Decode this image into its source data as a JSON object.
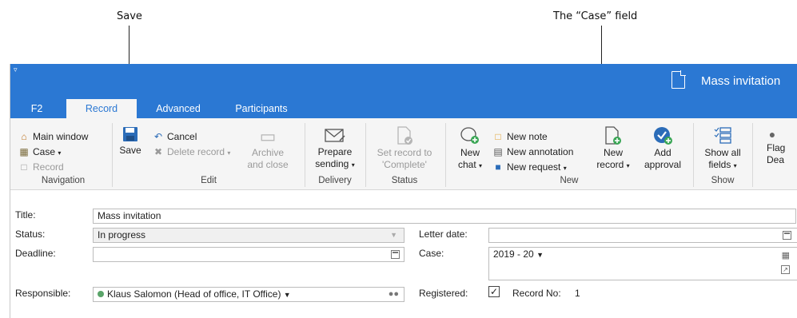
{
  "annotations": {
    "save": "Save",
    "case_field": "The “Case” field"
  },
  "window": {
    "title": "Mass invitation",
    "tabs": [
      "F2",
      "Record",
      "Advanced",
      "Participants"
    ],
    "active_tab": "Record",
    "accent": "#2b78d3"
  },
  "ribbon": {
    "navigation": {
      "items": [
        "Main window",
        "Case",
        "Record"
      ],
      "label": "Navigation"
    },
    "edit": {
      "save": "Save",
      "cancel": "Cancel",
      "delete_record": "Delete record",
      "archive_line1": "Archive",
      "archive_line2": "and close",
      "label": "Edit"
    },
    "delivery": {
      "prepare_line1": "Prepare",
      "prepare_line2": "sending",
      "label": "Delivery"
    },
    "status": {
      "set_line1": "Set record to",
      "set_line2": "'Complete'",
      "label": "Status"
    },
    "new": {
      "chat_line1": "New",
      "chat_line2": "chat",
      "new_note": "New note",
      "new_annotation": "New annotation",
      "new_request": "New request",
      "new_record_line1": "New",
      "new_record_line2": "record",
      "add_approval_line1": "Add",
      "add_approval_line2": "approval",
      "label": "New"
    },
    "show": {
      "line1": "Show all",
      "line2": "fields",
      "label": "Show"
    },
    "flag": {
      "line1": "Flag",
      "line2": "Dea"
    }
  },
  "form": {
    "title_label": "Title:",
    "title_value": "Mass invitation",
    "status_label": "Status:",
    "status_value": "In progress",
    "deadline_label": "Deadline:",
    "deadline_value": "",
    "responsible_label": "Responsible:",
    "responsible_value": "Klaus Salomon (Head of office, IT Office)",
    "letter_date_label": "Letter date:",
    "letter_date_value": "",
    "case_label": "Case:",
    "case_value": "2019 - 20",
    "registered_label": "Registered:",
    "record_no_label": "Record No:",
    "record_no_value": "1"
  }
}
